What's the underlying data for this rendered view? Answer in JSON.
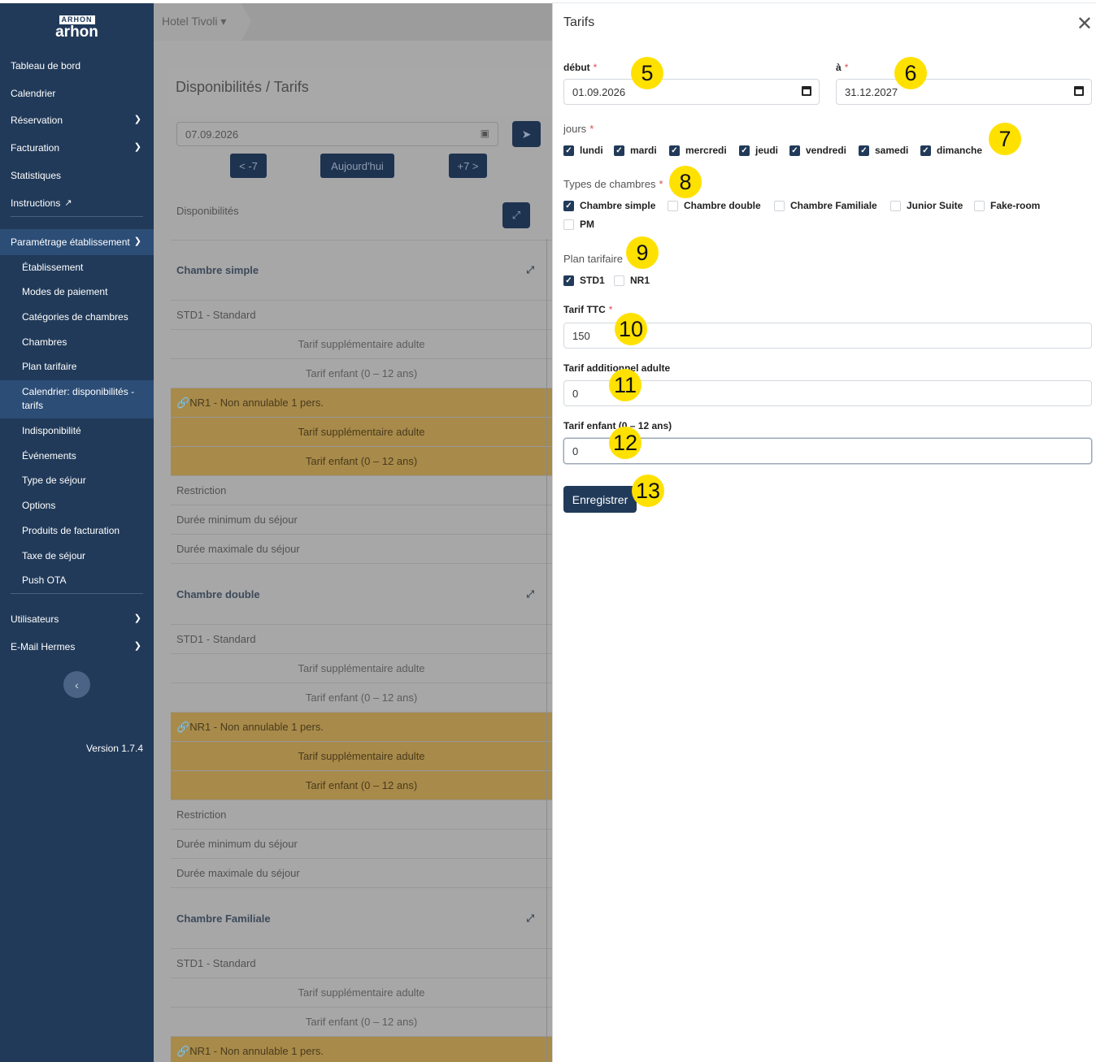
{
  "sidebar": {
    "logo_mark": "ARHON",
    "logo_text": "arhon",
    "items": [
      {
        "label": "Tableau de bord"
      },
      {
        "label": "Calendrier"
      },
      {
        "label": "Réservation"
      },
      {
        "label": "Facturation"
      },
      {
        "label": "Statistiques"
      },
      {
        "label": "Instructions"
      }
    ],
    "section_label": "Paramétrage établissement",
    "subitems": [
      {
        "label": "Établissement"
      },
      {
        "label": "Modes de paiement"
      },
      {
        "label": "Catégories de chambres"
      },
      {
        "label": "Chambres"
      },
      {
        "label": "Plan tarifaire"
      },
      {
        "label": "Calendrier: disponibilités -"
      },
      {
        "label": "tarifs"
      },
      {
        "label": "Indisponibilité"
      },
      {
        "label": "Événements"
      },
      {
        "label": "Type de séjour"
      },
      {
        "label": "Options"
      },
      {
        "label": "Produits de facturation"
      },
      {
        "label": "Taxe de séjour"
      },
      {
        "label": "Push OTA"
      }
    ],
    "bottom_items": [
      {
        "label": "Utilisateurs"
      },
      {
        "label": "E-Mail Hermes"
      }
    ],
    "version": "Version 1.7.4"
  },
  "main": {
    "breadcrumb": "Hotel Tivoli ▾",
    "page_title": "Disponibilités / Tarifs",
    "date_value": "07.09.2026",
    "prev_label": "< -7",
    "today_label": "Aujourd'hui",
    "next_label": "+7 >",
    "dispo_label": "Disponibilités",
    "rows": [
      {
        "text": "Chambre simple"
      },
      {
        "text": "STD1 - Standard"
      },
      {
        "text": "Tarif supplémentaire adulte"
      },
      {
        "text": "Tarif enfant (0 – 12 ans)"
      },
      {
        "text": "NR1 - Non annulable 1 pers."
      },
      {
        "text": "Tarif supplémentaire adulte"
      },
      {
        "text": "Tarif enfant (0 – 12 ans)"
      },
      {
        "text": "Restriction"
      },
      {
        "text": "Durée minimum du séjour"
      },
      {
        "text": "Durée maximale du séjour"
      },
      {
        "text": "Chambre double"
      },
      {
        "text": "STD1 - Standard"
      },
      {
        "text": "Tarif supplémentaire adulte"
      },
      {
        "text": "Tarif enfant (0 – 12 ans)"
      },
      {
        "text": "NR1 - Non annulable 1 pers."
      },
      {
        "text": "Tarif supplémentaire adulte"
      },
      {
        "text": "Tarif enfant (0 – 12 ans)"
      },
      {
        "text": "Restriction"
      },
      {
        "text": "Durée minimum du séjour"
      },
      {
        "text": "Durée maximale du séjour"
      },
      {
        "text": "Chambre Familiale"
      },
      {
        "text": "STD1 - Standard"
      },
      {
        "text": "Tarif supplémentaire adulte"
      },
      {
        "text": "Tarif enfant (0 – 12 ans)"
      },
      {
        "text": "NR1 - Non annulable 1 pers."
      }
    ]
  },
  "panel": {
    "title": "Tarifs",
    "debut_label": "début",
    "debut_value": "01.09.2026",
    "a_label": "à",
    "a_value": "31.12.2027",
    "jours_label": "jours",
    "jours": [
      "lundi",
      "mardi",
      "mercredi",
      "jeudi",
      "vendredi",
      "samedi",
      "dimanche"
    ],
    "types_label": "Types de chambres",
    "types": [
      {
        "label": "Chambre simple",
        "checked": true
      },
      {
        "label": "Chambre double",
        "checked": false
      },
      {
        "label": "Chambre Familiale",
        "checked": false
      },
      {
        "label": "Junior Suite",
        "checked": false
      },
      {
        "label": "Fake-room",
        "checked": false
      },
      {
        "label": "PM",
        "checked": false
      }
    ],
    "plan_label": "Plan tarifaire",
    "plans": [
      {
        "label": "STD1",
        "checked": true
      },
      {
        "label": "NR1",
        "checked": false
      }
    ],
    "tarif_ttc_label": "Tarif TTC",
    "tarif_ttc_value": "150",
    "tarif_add_label": "Tarif additionnel adulte",
    "tarif_add_value": "0",
    "tarif_enfant_label": "Tarif enfant (0 – 12 ans)",
    "tarif_enfant_value": "0",
    "save_label": "Enregistrer",
    "required_mark": "*"
  },
  "badges": [
    "5",
    "6",
    "7",
    "8",
    "9",
    "10",
    "11",
    "12",
    "13"
  ],
  "colors": {
    "sidebar": "#213a59",
    "accent": "#213a59",
    "badge": "#ffe100",
    "nr1_row": "#a88a4a"
  }
}
